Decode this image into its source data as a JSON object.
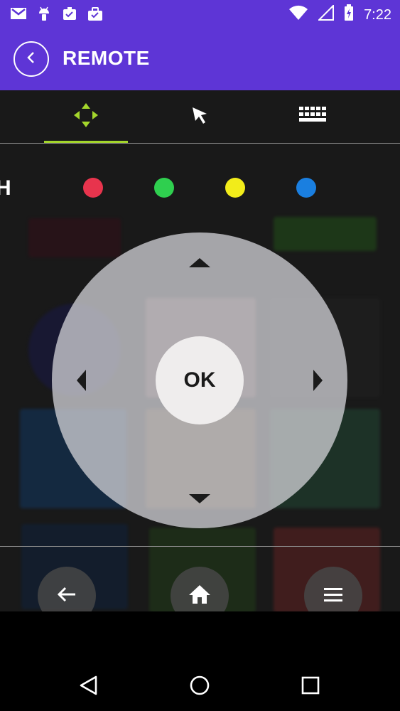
{
  "status_bar": {
    "time": "7:22",
    "icons_left": [
      "gmail-icon",
      "android-icon",
      "clipboard-check-icon",
      "briefcase-check-icon"
    ],
    "icons_right": [
      "wifi-icon",
      "signal-icon",
      "battery-charging-icon"
    ]
  },
  "app_bar": {
    "title": "REMOTE",
    "back_icon": "chevron-left-icon",
    "color": "#5e35d6"
  },
  "tabs": [
    {
      "id": "dpad",
      "icon": "dpad-arrows-icon",
      "selected": true
    },
    {
      "id": "pointer",
      "icon": "cursor-arrow-icon",
      "selected": false
    },
    {
      "id": "keyboard",
      "icon": "keyboard-icon",
      "selected": false
    }
  ],
  "accent_color": "#a4d62c",
  "partial_text": "H",
  "color_keys": [
    {
      "name": "red",
      "color": "#e8344d"
    },
    {
      "name": "green",
      "color": "#2fcf4f"
    },
    {
      "name": "yellow",
      "color": "#f2ec1a"
    },
    {
      "name": "blue",
      "color": "#1a7fe0"
    }
  ],
  "dpad": {
    "ok_label": "OK",
    "arrows": [
      "up",
      "down",
      "left",
      "right"
    ]
  },
  "bottom_actions": [
    {
      "name": "back",
      "icon": "arrow-left-icon"
    },
    {
      "name": "home",
      "icon": "home-icon"
    },
    {
      "name": "menu",
      "icon": "menu-icon"
    }
  ],
  "nav_bar": [
    "back-triangle-icon",
    "home-circle-icon",
    "recents-square-icon"
  ]
}
